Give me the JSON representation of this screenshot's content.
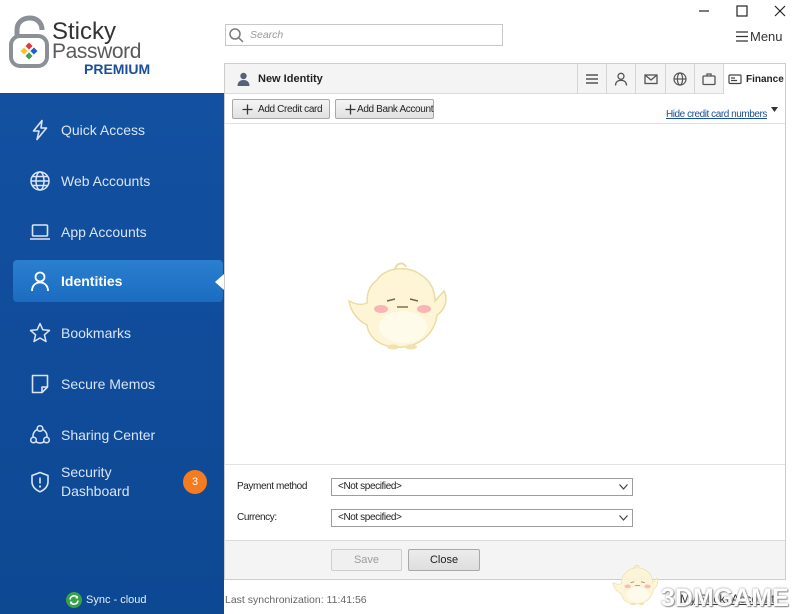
{
  "logo": {
    "line1": "Sticky",
    "line2": "Password",
    "edition": "PREMIUM",
    "icon": "padlock-logo-icon"
  },
  "window_controls": {
    "minimize_icon": "minimize-icon",
    "maximize_icon": "maximize-icon",
    "close_icon": "close-icon"
  },
  "search": {
    "placeholder": "Search",
    "icon": "search-icon"
  },
  "menu": {
    "label": "Menu",
    "icon": "hamburger-icon"
  },
  "sidebar": {
    "items": [
      {
        "label": "Quick Access",
        "icon": "lightning-icon",
        "selected": false
      },
      {
        "label": "Web Accounts",
        "icon": "globe-icon",
        "selected": false
      },
      {
        "label": "App Accounts",
        "icon": "laptop-icon",
        "selected": false
      },
      {
        "label": "Identities",
        "icon": "person-icon",
        "selected": true
      },
      {
        "label": "Bookmarks",
        "icon": "star-icon",
        "selected": false
      },
      {
        "label": "Secure Memos",
        "icon": "note-icon",
        "selected": false
      },
      {
        "label": "Sharing Center",
        "icon": "share-icon",
        "selected": false
      },
      {
        "label": "Security Dashboard",
        "icon": "shield-alert-icon",
        "selected": false,
        "badge": "3"
      }
    ],
    "sync": {
      "label": "Sync - cloud",
      "icon": "sync-icon"
    }
  },
  "panel": {
    "header": {
      "title": "New Identity",
      "icon": "person-icon",
      "tabs": [
        {
          "icon": "list-icon",
          "selected": false
        },
        {
          "icon": "person-icon",
          "selected": false
        },
        {
          "icon": "envelope-icon",
          "selected": false
        },
        {
          "icon": "globe-icon",
          "selected": false
        },
        {
          "icon": "briefcase-icon",
          "selected": false
        },
        {
          "icon": "credit-card-icon",
          "label": "Finance",
          "selected": true
        }
      ]
    },
    "toolbar": {
      "add_credit_card": "Add Credit card",
      "add_bank_account": "Add Bank Account",
      "hide_numbers": "Hide credit card numbers"
    },
    "form": {
      "payment_method": {
        "label": "Payment method",
        "value": "<Not specified>"
      },
      "currency": {
        "label": "Currency:",
        "value": "<Not specified>"
      }
    },
    "buttons": {
      "save": "Save",
      "save_enabled": false,
      "close": "Close"
    }
  },
  "status": {
    "last_sync": "Last synchronization: 11:41:56",
    "my_account": "My StickyAccount"
  },
  "watermark": {
    "text": "3DMGAME"
  },
  "colors": {
    "sidebar": "#1350a1",
    "sidebar_selected": "#1f73c6",
    "badge": "#f47b20",
    "brand_blue": "#1b4f9a",
    "sync_green": "#3aa04a"
  }
}
